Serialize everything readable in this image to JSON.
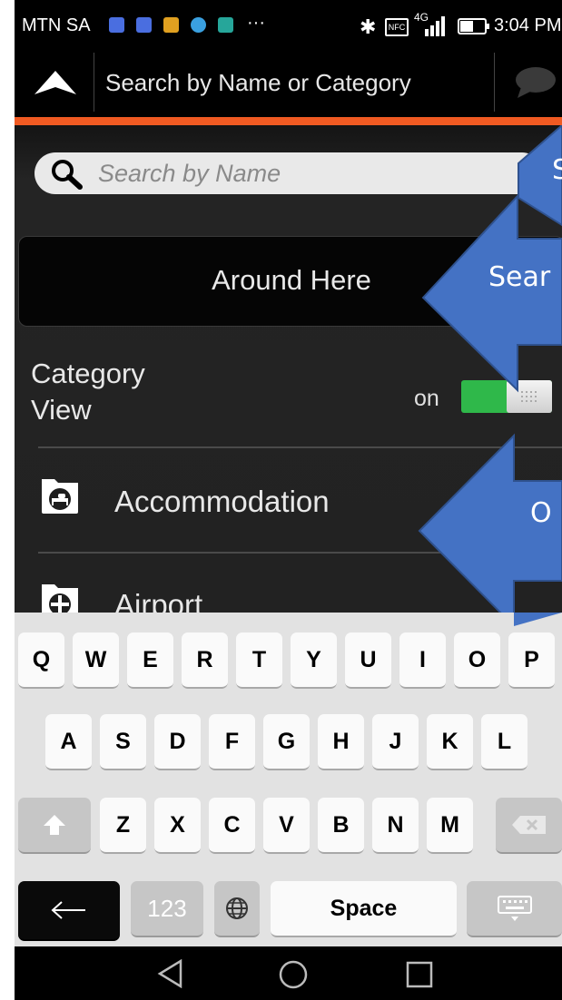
{
  "status_bar": {
    "carrier": "MTN SA",
    "more": "···",
    "network": "4G",
    "time": "3:04 PM"
  },
  "app_bar": {
    "title": "Search by Name or Category"
  },
  "search": {
    "placeholder": "Search by Name"
  },
  "around_here": {
    "label": "Around Here"
  },
  "category_view": {
    "label": "Category\nView",
    "toggle_label": "on",
    "toggle_on": true
  },
  "categories": [
    {
      "label": "Accommodation",
      "icon": "bed-icon"
    },
    {
      "label": "Airport",
      "icon": "airport-icon"
    }
  ],
  "annotations": {
    "arrow1_text": "S",
    "arrow2_text": "Sear",
    "arrow3_text": "O",
    "color": "#4472c4"
  },
  "keyboard": {
    "row1": [
      "Q",
      "W",
      "E",
      "R",
      "T",
      "Y",
      "U",
      "I",
      "O",
      "P"
    ],
    "row2": [
      "A",
      "S",
      "D",
      "F",
      "G",
      "H",
      "J",
      "K",
      "L"
    ],
    "row3": [
      "Z",
      "X",
      "C",
      "V",
      "B",
      "N",
      "M"
    ],
    "numbers_label": "123",
    "space_label": "Space"
  },
  "colors": {
    "accent": "#f05a22",
    "toggle_on": "#2fb84a"
  }
}
